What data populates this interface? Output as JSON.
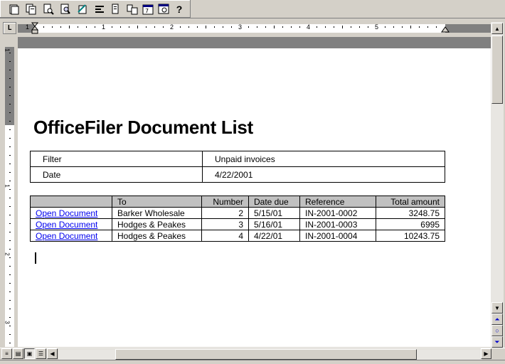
{
  "toolbar": {
    "buttons": [
      "new-document-icon",
      "copy-documents-icon",
      "open-filer-icon",
      "search-documents-icon",
      "edit-document-icon",
      "list-view-icon",
      "properties-icon",
      "folder-view-icon",
      "calendar-icon",
      "document-preview-icon",
      "help-icon"
    ],
    "help_glyph": "?"
  },
  "ruler": {
    "tab_selector": "L",
    "horizontal_numbers": [
      "1",
      "1",
      "2",
      "3",
      "4",
      "5"
    ],
    "vertical_numbers": [
      "1",
      "1",
      "2",
      "3"
    ]
  },
  "document": {
    "title": "OfficeFiler Document List",
    "filter": [
      {
        "label": "Filter",
        "value": "Unpaid invoices"
      },
      {
        "label": "Date",
        "value": "4/22/2001"
      }
    ],
    "columns": [
      "",
      "To",
      "Number",
      "Date due",
      "Reference",
      "Total amount"
    ],
    "rows": [
      {
        "link": "Open Document",
        "to": "Barker Wholesale",
        "number": "2",
        "date_due": "5/15/01",
        "reference": "IN-2001-0002",
        "total": "3248.75"
      },
      {
        "link": "Open Document",
        "to": "Hodges & Peakes",
        "number": "3",
        "date_due": "5/16/01",
        "reference": "IN-2001-0003",
        "total": "6995"
      },
      {
        "link": "Open Document",
        "to": "Hodges & Peakes",
        "number": "4",
        "date_due": "4/22/01",
        "reference": "IN-2001-0004",
        "total": "10243.75"
      }
    ]
  },
  "colors": {
    "link": "#0000ee",
    "chrome": "#d4d0c8",
    "header_cell": "#c0c0c0"
  }
}
